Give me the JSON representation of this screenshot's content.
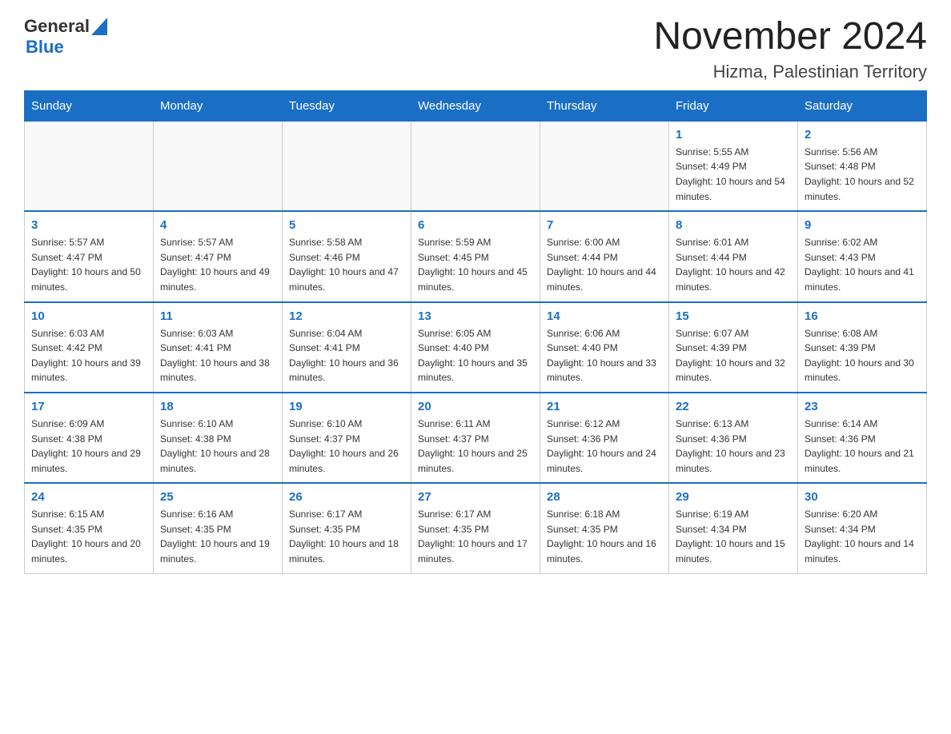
{
  "header": {
    "logo_general": "General",
    "logo_blue": "Blue",
    "month_title": "November 2024",
    "location": "Hizma, Palestinian Territory"
  },
  "days_of_week": [
    "Sunday",
    "Monday",
    "Tuesday",
    "Wednesday",
    "Thursday",
    "Friday",
    "Saturday"
  ],
  "weeks": [
    [
      {
        "day": "",
        "info": ""
      },
      {
        "day": "",
        "info": ""
      },
      {
        "day": "",
        "info": ""
      },
      {
        "day": "",
        "info": ""
      },
      {
        "day": "",
        "info": ""
      },
      {
        "day": "1",
        "info": "Sunrise: 5:55 AM\nSunset: 4:49 PM\nDaylight: 10 hours and 54 minutes."
      },
      {
        "day": "2",
        "info": "Sunrise: 5:56 AM\nSunset: 4:48 PM\nDaylight: 10 hours and 52 minutes."
      }
    ],
    [
      {
        "day": "3",
        "info": "Sunrise: 5:57 AM\nSunset: 4:47 PM\nDaylight: 10 hours and 50 minutes."
      },
      {
        "day": "4",
        "info": "Sunrise: 5:57 AM\nSunset: 4:47 PM\nDaylight: 10 hours and 49 minutes."
      },
      {
        "day": "5",
        "info": "Sunrise: 5:58 AM\nSunset: 4:46 PM\nDaylight: 10 hours and 47 minutes."
      },
      {
        "day": "6",
        "info": "Sunrise: 5:59 AM\nSunset: 4:45 PM\nDaylight: 10 hours and 45 minutes."
      },
      {
        "day": "7",
        "info": "Sunrise: 6:00 AM\nSunset: 4:44 PM\nDaylight: 10 hours and 44 minutes."
      },
      {
        "day": "8",
        "info": "Sunrise: 6:01 AM\nSunset: 4:44 PM\nDaylight: 10 hours and 42 minutes."
      },
      {
        "day": "9",
        "info": "Sunrise: 6:02 AM\nSunset: 4:43 PM\nDaylight: 10 hours and 41 minutes."
      }
    ],
    [
      {
        "day": "10",
        "info": "Sunrise: 6:03 AM\nSunset: 4:42 PM\nDaylight: 10 hours and 39 minutes."
      },
      {
        "day": "11",
        "info": "Sunrise: 6:03 AM\nSunset: 4:41 PM\nDaylight: 10 hours and 38 minutes."
      },
      {
        "day": "12",
        "info": "Sunrise: 6:04 AM\nSunset: 4:41 PM\nDaylight: 10 hours and 36 minutes."
      },
      {
        "day": "13",
        "info": "Sunrise: 6:05 AM\nSunset: 4:40 PM\nDaylight: 10 hours and 35 minutes."
      },
      {
        "day": "14",
        "info": "Sunrise: 6:06 AM\nSunset: 4:40 PM\nDaylight: 10 hours and 33 minutes."
      },
      {
        "day": "15",
        "info": "Sunrise: 6:07 AM\nSunset: 4:39 PM\nDaylight: 10 hours and 32 minutes."
      },
      {
        "day": "16",
        "info": "Sunrise: 6:08 AM\nSunset: 4:39 PM\nDaylight: 10 hours and 30 minutes."
      }
    ],
    [
      {
        "day": "17",
        "info": "Sunrise: 6:09 AM\nSunset: 4:38 PM\nDaylight: 10 hours and 29 minutes."
      },
      {
        "day": "18",
        "info": "Sunrise: 6:10 AM\nSunset: 4:38 PM\nDaylight: 10 hours and 28 minutes."
      },
      {
        "day": "19",
        "info": "Sunrise: 6:10 AM\nSunset: 4:37 PM\nDaylight: 10 hours and 26 minutes."
      },
      {
        "day": "20",
        "info": "Sunrise: 6:11 AM\nSunset: 4:37 PM\nDaylight: 10 hours and 25 minutes."
      },
      {
        "day": "21",
        "info": "Sunrise: 6:12 AM\nSunset: 4:36 PM\nDaylight: 10 hours and 24 minutes."
      },
      {
        "day": "22",
        "info": "Sunrise: 6:13 AM\nSunset: 4:36 PM\nDaylight: 10 hours and 23 minutes."
      },
      {
        "day": "23",
        "info": "Sunrise: 6:14 AM\nSunset: 4:36 PM\nDaylight: 10 hours and 21 minutes."
      }
    ],
    [
      {
        "day": "24",
        "info": "Sunrise: 6:15 AM\nSunset: 4:35 PM\nDaylight: 10 hours and 20 minutes."
      },
      {
        "day": "25",
        "info": "Sunrise: 6:16 AM\nSunset: 4:35 PM\nDaylight: 10 hours and 19 minutes."
      },
      {
        "day": "26",
        "info": "Sunrise: 6:17 AM\nSunset: 4:35 PM\nDaylight: 10 hours and 18 minutes."
      },
      {
        "day": "27",
        "info": "Sunrise: 6:17 AM\nSunset: 4:35 PM\nDaylight: 10 hours and 17 minutes."
      },
      {
        "day": "28",
        "info": "Sunrise: 6:18 AM\nSunset: 4:35 PM\nDaylight: 10 hours and 16 minutes."
      },
      {
        "day": "29",
        "info": "Sunrise: 6:19 AM\nSunset: 4:34 PM\nDaylight: 10 hours and 15 minutes."
      },
      {
        "day": "30",
        "info": "Sunrise: 6:20 AM\nSunset: 4:34 PM\nDaylight: 10 hours and 14 minutes."
      }
    ]
  ]
}
